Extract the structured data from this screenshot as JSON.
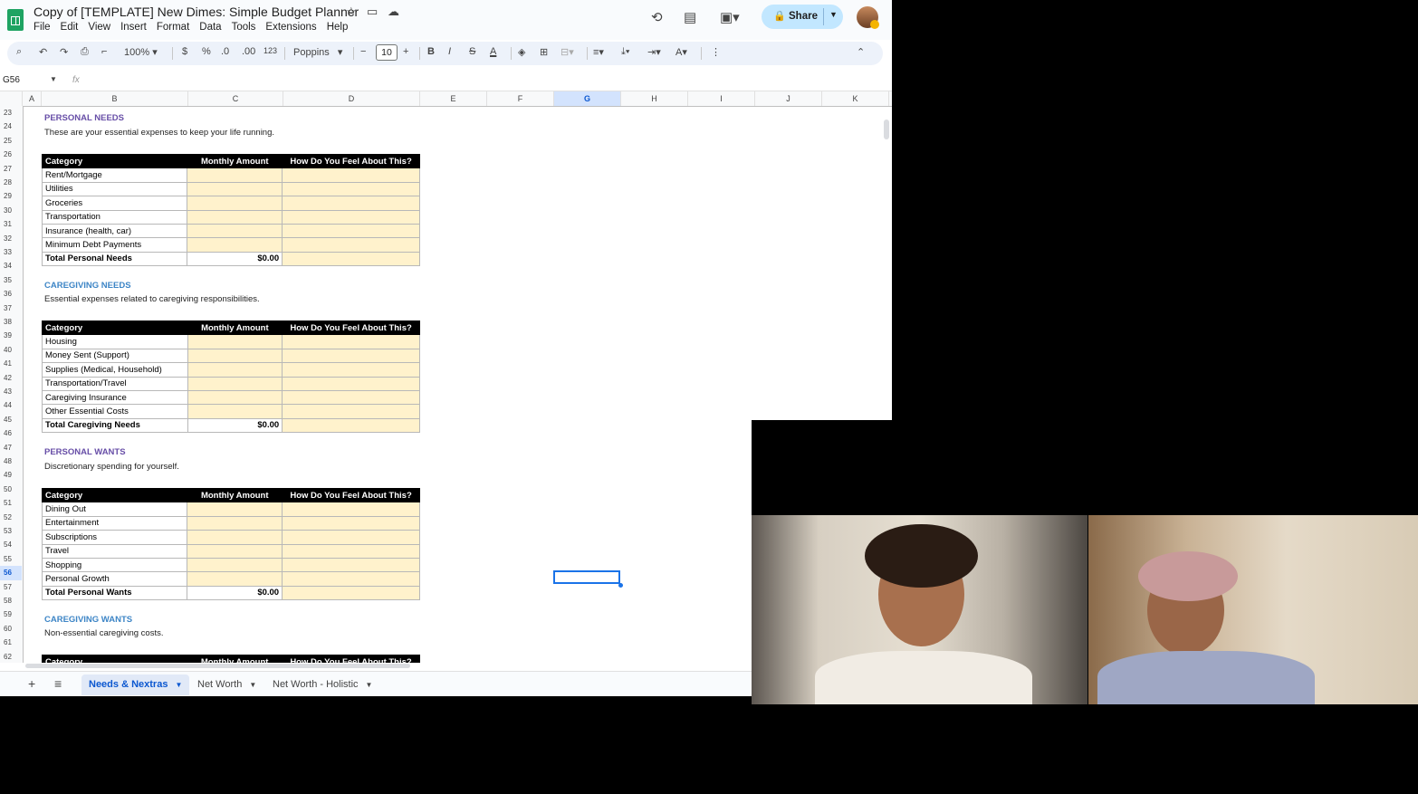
{
  "doc": {
    "title": "Copy of [TEMPLATE] New Dimes: Simple Budget Planner",
    "menu": [
      "File",
      "Edit",
      "View",
      "Insert",
      "Format",
      "Data",
      "Tools",
      "Extensions",
      "Help"
    ],
    "share_label": "Share"
  },
  "toolbar": {
    "zoom": "100%",
    "currency": "$",
    "percent": "%",
    "dec_decrease": ".0",
    "dec_increase": ".00",
    "number_format": "123",
    "font": "Poppins",
    "font_size": "10"
  },
  "formula_bar": {
    "name_box": "G56",
    "fx": "fx"
  },
  "columns": [
    "A",
    "B",
    "C",
    "D",
    "E",
    "F",
    "G",
    "H",
    "I",
    "J",
    "K"
  ],
  "selected_column": "G",
  "rows": [
    "23",
    "24",
    "25",
    "26",
    "27",
    "28",
    "29",
    "30",
    "31",
    "32",
    "33",
    "34",
    "35",
    "36",
    "37",
    "38",
    "39",
    "40",
    "41",
    "42",
    "43",
    "44",
    "45",
    "46",
    "47",
    "48",
    "49",
    "50",
    "51",
    "52",
    "53",
    "54",
    "55",
    "56",
    "57",
    "58",
    "59",
    "60",
    "61",
    "62"
  ],
  "selected_row": "56",
  "table_headers": {
    "category": "Category",
    "amount": "Monthly Amount",
    "feel": "How Do You Feel About This?"
  },
  "sections": [
    {
      "title": "PERSONAL NEEDS",
      "color": "#674ea7",
      "description": "These are your essential expenses to keep your life running.",
      "items": [
        "Rent/Mortgage",
        "Utilities",
        "Groceries",
        "Transportation",
        "Insurance (health, car)",
        "Minimum Debt Payments"
      ],
      "total_label": "Total Personal Needs",
      "total_value": "$0.00"
    },
    {
      "title": "CAREGIVING NEEDS",
      "color": "#3d85c6",
      "description": "Essential expenses related to caregiving responsibilities.",
      "items": [
        "Housing",
        "Money Sent (Support)",
        "Supplies (Medical, Household)",
        "Transportation/Travel",
        "Caregiving Insurance",
        "Other Essential Costs"
      ],
      "total_label": "Total Caregiving Needs",
      "total_value": "$0.00"
    },
    {
      "title": "PERSONAL WANTS",
      "color": "#674ea7",
      "description": "Discretionary spending for yourself.",
      "items": [
        "Dining Out",
        "Entertainment",
        "Subscriptions",
        "Travel",
        "Shopping",
        "Personal Growth"
      ],
      "total_label": "Total Personal Wants",
      "total_value": "$0.00"
    },
    {
      "title": "CAREGIVING WANTS",
      "color": "#3d85c6",
      "description": "Non-essential caregiving costs."
    }
  ],
  "sheet_tabs": [
    "Needs & Nextras",
    "Net Worth",
    "Net Worth - Holistic"
  ],
  "active_tab": "Needs & Nextras"
}
